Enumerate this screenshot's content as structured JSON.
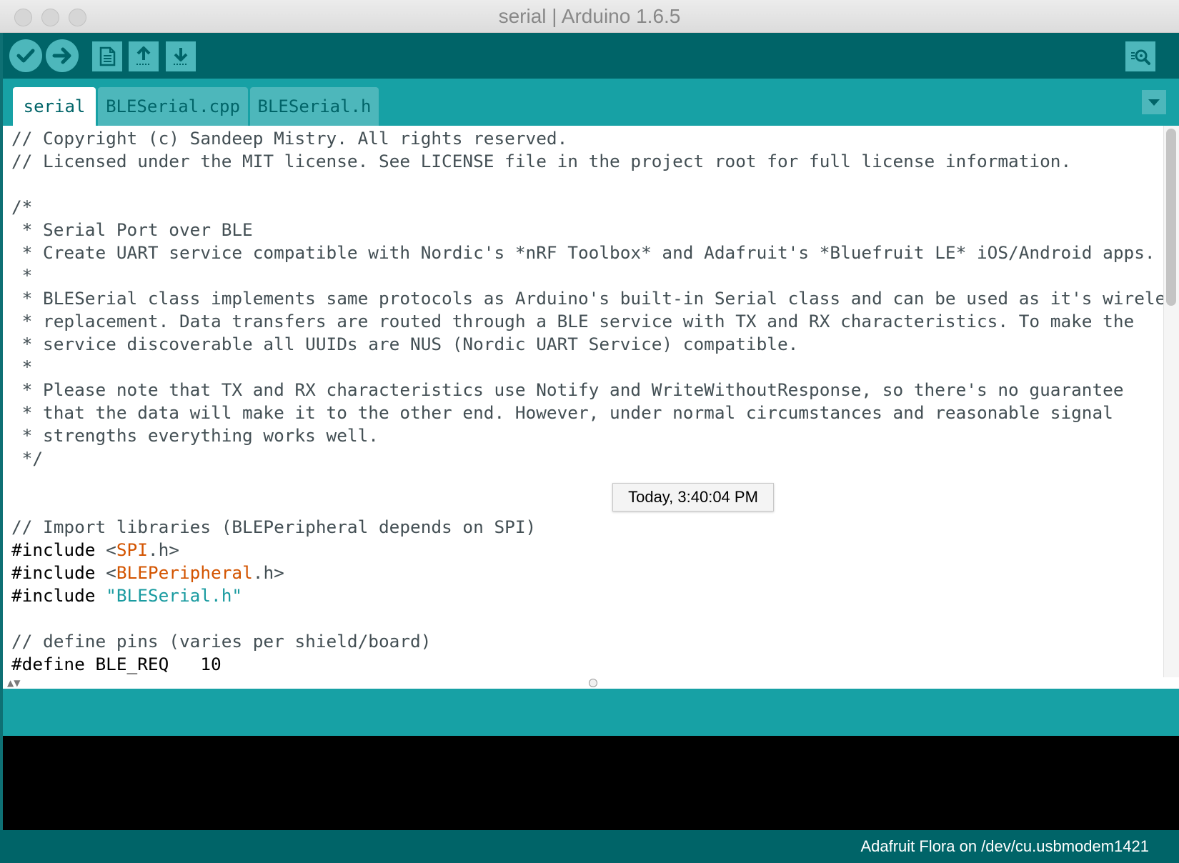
{
  "window": {
    "title": "serial | Arduino 1.6.5"
  },
  "toolbar": {
    "buttons": [
      {
        "name": "verify",
        "icon": "check-icon"
      },
      {
        "name": "upload",
        "icon": "arrow-right-icon"
      },
      {
        "name": "new",
        "icon": "new-file-icon"
      },
      {
        "name": "open",
        "icon": "open-arrow-up-icon"
      },
      {
        "name": "save",
        "icon": "save-arrow-down-icon"
      },
      {
        "name": "serial-monitor",
        "icon": "magnifier-icon"
      }
    ]
  },
  "tabs": [
    {
      "label": "serial",
      "active": true
    },
    {
      "label": "BLESerial.cpp",
      "active": false
    },
    {
      "label": "BLESerial.h",
      "active": false
    }
  ],
  "editor": {
    "lines": [
      [
        {
          "t": "// Copyright (c) Sandeep Mistry. All rights reserved.",
          "c": "kw"
        }
      ],
      [
        {
          "t": "// Licensed under the MIT license. See LICENSE file in the project root for full license information.",
          "c": "kw"
        }
      ],
      [
        {
          "t": "",
          "c": "kw"
        }
      ],
      [
        {
          "t": "/*",
          "c": "kw"
        }
      ],
      [
        {
          "t": " * Serial Port over BLE",
          "c": "kw"
        }
      ],
      [
        {
          "t": " * Create UART service compatible with Nordic's *nRF Toolbox* and Adafruit's *Bluefruit LE* iOS/Android apps.",
          "c": "kw"
        }
      ],
      [
        {
          "t": " *",
          "c": "kw"
        }
      ],
      [
        {
          "t": " * BLESerial class implements same protocols as Arduino's built-in Serial class and can be used as it's wireless",
          "c": "kw"
        }
      ],
      [
        {
          "t": " * replacement. Data transfers are routed through a BLE service with TX and RX characteristics. To make the",
          "c": "kw"
        }
      ],
      [
        {
          "t": " * service discoverable all UUIDs are NUS (Nordic UART Service) compatible.",
          "c": "kw"
        }
      ],
      [
        {
          "t": " *",
          "c": "kw"
        }
      ],
      [
        {
          "t": " * Please note that TX and RX characteristics use Notify and WriteWithoutResponse, so there's no guarantee",
          "c": "kw"
        }
      ],
      [
        {
          "t": " * that the data will make it to the other end. However, under normal circumstances and reasonable signal",
          "c": "kw"
        }
      ],
      [
        {
          "t": " * strengths everything works well.",
          "c": "kw"
        }
      ],
      [
        {
          "t": " */",
          "c": "kw"
        }
      ],
      [
        {
          "t": "",
          "c": "kw"
        }
      ],
      [
        {
          "t": "",
          "c": "kw"
        }
      ],
      [
        {
          "t": "// Import libraries (BLEPeripheral depends on SPI)",
          "c": "kw"
        }
      ],
      [
        {
          "t": "#include ",
          "c": "dir"
        },
        {
          "t": "<",
          "c": "kw"
        },
        {
          "t": "SPI",
          "c": "lib"
        },
        {
          "t": ".h>",
          "c": "kw"
        }
      ],
      [
        {
          "t": "#include ",
          "c": "dir"
        },
        {
          "t": "<",
          "c": "kw"
        },
        {
          "t": "BLEPeripheral",
          "c": "lib"
        },
        {
          "t": ".h>",
          "c": "kw"
        }
      ],
      [
        {
          "t": "#include ",
          "c": "dir"
        },
        {
          "t": "\"BLESerial.h\"",
          "c": "str"
        }
      ],
      [
        {
          "t": "",
          "c": "kw"
        }
      ],
      [
        {
          "t": "// define pins (varies per shield/board)",
          "c": "kw"
        }
      ],
      [
        {
          "t": "#define BLE_REQ   10",
          "c": "dir"
        }
      ]
    ]
  },
  "tooltip": {
    "text": "Today, 3:40:04 PM"
  },
  "status": {
    "board_port": "Adafruit Flora on /dev/cu.usbmodem1421"
  },
  "colors": {
    "toolbar": "#006468",
    "tabstrip": "#17a1a5",
    "button": "#4db7bb",
    "library": "#d35400",
    "string": "#1a9ba0"
  }
}
